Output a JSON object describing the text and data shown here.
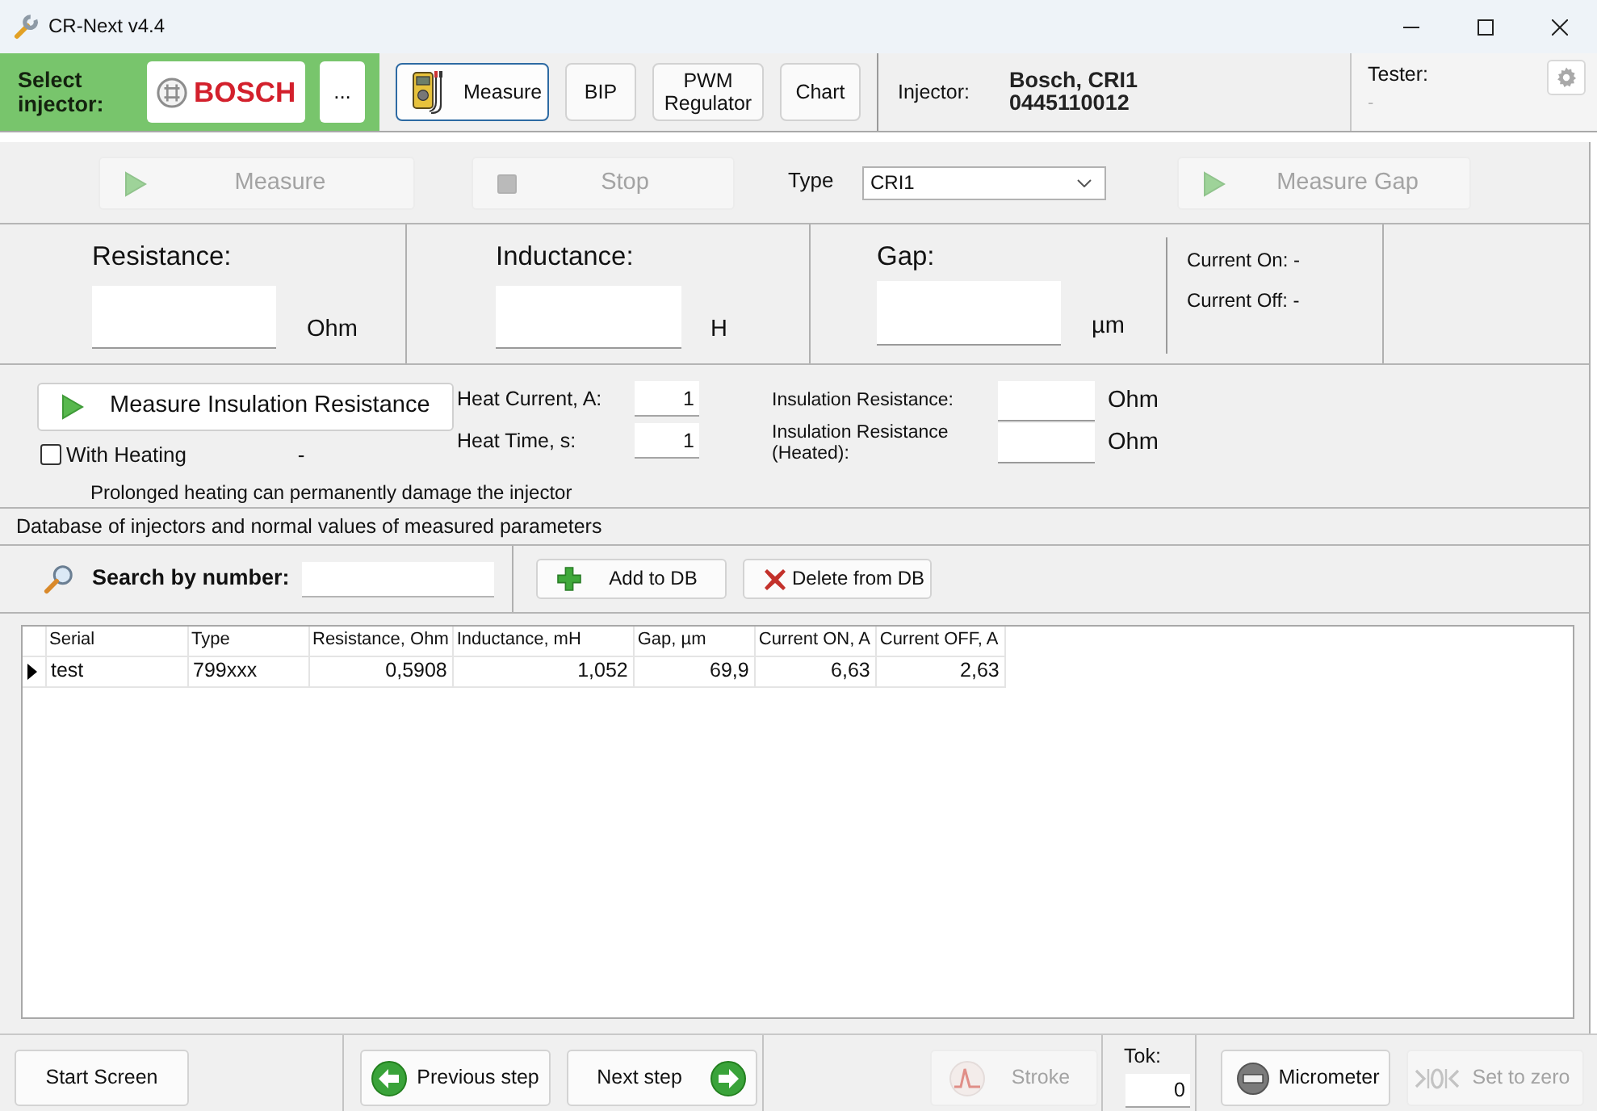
{
  "window": {
    "title": "CR-Next v4.4"
  },
  "injector_bar": {
    "label": "Select injector:",
    "brand_button": "BOSCH",
    "more_button": "...",
    "tabs": [
      {
        "label": "Measure",
        "kind": "meter",
        "selected": true
      },
      {
        "label": "BIP",
        "kind": "text",
        "selected": false
      },
      {
        "label": "PWM Regulator",
        "kind": "text",
        "selected": false
      },
      {
        "label": "Chart",
        "kind": "text",
        "selected": false
      }
    ],
    "injector_label": "Injector:",
    "injector_name": "Bosch, CRI1",
    "injector_number": "0445110012",
    "tester_label": "Tester:",
    "tester_value": "-"
  },
  "measure_bar": {
    "buttons": [
      {
        "label": "Measure",
        "kind": "play",
        "disabled": true
      },
      {
        "label": "Stop",
        "kind": "stop",
        "disabled": true
      }
    ],
    "type_label": "Type",
    "type_value": "CRI1",
    "gap_button": {
      "label": "Measure Gap",
      "disabled": true
    }
  },
  "readings": [
    {
      "label": "Resistance:",
      "unit": "Ohm"
    },
    {
      "label": "Inductance:",
      "unit": "H"
    },
    {
      "label": "Gap:",
      "unit": "µm"
    }
  ],
  "currents": [
    "Current On: -",
    "Current Off: -"
  ],
  "insulation": {
    "button": "Measure Insulation Resistance",
    "with_heating": {
      "label": "With Heating",
      "checked": false
    },
    "heating_status": "-",
    "warning": "Prolonged heating can permanently damage the injector",
    "params": [
      {
        "label": "Heat Current, A:",
        "value": "1"
      },
      {
        "label": "Heat Time, s:",
        "value": "1"
      }
    ],
    "results": [
      {
        "label": "Insulation Resistance:",
        "unit": "Ohm"
      },
      {
        "label": "Insulation Resistance (Heated):",
        "unit": "Ohm"
      }
    ]
  },
  "database": {
    "title": "Database of injectors and normal values of measured parameters",
    "search_label": "Search by number:",
    "buttons": [
      {
        "label": "Add to DB",
        "kind": "add"
      },
      {
        "label": "Delete from DB",
        "kind": "delete"
      }
    ],
    "table": {
      "columns": [
        "Serial",
        "Type",
        "Resistance, Ohm",
        "Inductance, mH",
        "Gap, µm",
        "Current ON, A",
        "Current OFF, A"
      ],
      "rows": [
        {
          "selected": true,
          "cells": [
            "test",
            "799xxx",
            "0,5908",
            "1,052",
            "69,9",
            "6,63",
            "2,63"
          ]
        }
      ]
    }
  },
  "footer": {
    "start_button": {
      "label": "Start Screen",
      "disabled": false
    },
    "step_buttons": [
      {
        "label": "Previous step",
        "kind": "previous",
        "disabled": false
      },
      {
        "label": "Next step",
        "kind": "next",
        "disabled": false
      }
    ],
    "stroke_button": {
      "label": "Stroke",
      "disabled": true
    },
    "tok": {
      "label": "Tok:",
      "value": "0"
    },
    "tool_buttons": [
      {
        "label": "Micrometer",
        "kind": "micrometer",
        "disabled": false
      },
      {
        "label": "Set to zero",
        "kind": "zero",
        "disabled": true
      }
    ]
  }
}
